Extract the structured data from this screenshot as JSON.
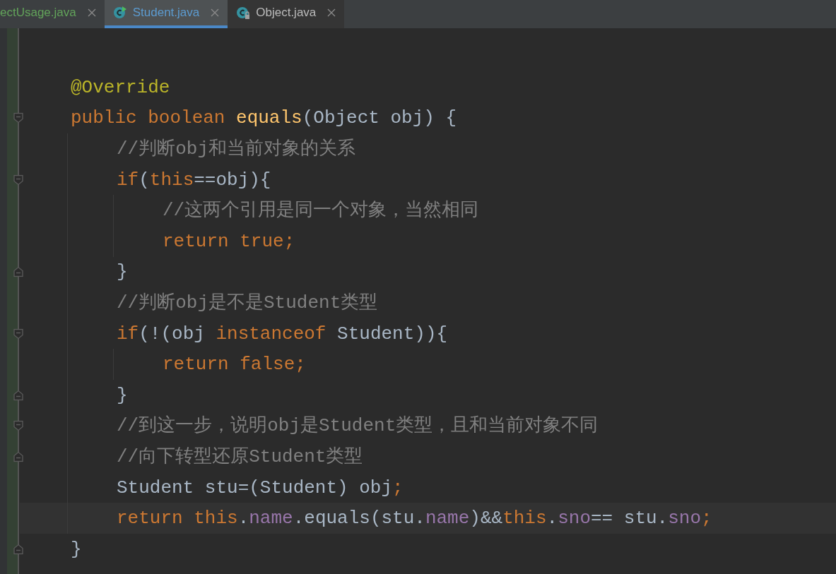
{
  "tabs": [
    {
      "label": "ectUsage.java",
      "selected": false,
      "kind": "plain",
      "color": "#62a35a"
    },
    {
      "label": "Student.java",
      "selected": true,
      "kind": "class-run",
      "color": "#5c9bd0"
    },
    {
      "label": "Object.java",
      "selected": false,
      "kind": "class-locked",
      "color": "#bbbbbb"
    }
  ],
  "code": [
    {
      "tokens": [
        {
          "text": "@Override",
          "kind": "annotation"
        }
      ]
    },
    {
      "kind": "fold-start",
      "tokens": [
        {
          "text": "public boolean ",
          "kind": "keyword"
        },
        {
          "text": "equals",
          "kind": "method"
        },
        {
          "text": "(Object obj) {",
          "kind": "plain"
        }
      ],
      "children": [
        {
          "tokens": [
            {
              "text": "//判断obj和当前对象的关系",
              "kind": "comment"
            }
          ]
        },
        {
          "kind": "fold-start",
          "tokens": [
            {
              "text": "if",
              "kind": "keyword"
            },
            {
              "text": "(",
              "kind": "plain"
            },
            {
              "text": "this",
              "kind": "keyword"
            },
            {
              "text": "==obj){",
              "kind": "plain"
            }
          ],
          "children": [
            {
              "tokens": [
                {
                  "text": "//这两个引用是同一个对象，当然相同",
                  "kind": "comment"
                }
              ]
            },
            {
              "tokens": [
                {
                  "text": "return true;",
                  "kind": "keyword"
                }
              ]
            }
          ]
        },
        {
          "kind": "fold-end",
          "tokens": [
            {
              "text": "}",
              "kind": "plain"
            }
          ]
        },
        {
          "tokens": [
            {
              "text": "//判断obj是不是Student类型",
              "kind": "comment"
            }
          ]
        },
        {
          "kind": "fold-start",
          "tokens": [
            {
              "text": "if",
              "kind": "keyword"
            },
            {
              "text": "(!(obj ",
              "kind": "plain"
            },
            {
              "text": "instanceof ",
              "kind": "keyword"
            },
            {
              "text": "Student)){",
              "kind": "plain"
            }
          ],
          "children": [
            {
              "tokens": [
                {
                  "text": "return false;",
                  "kind": "keyword"
                }
              ]
            }
          ]
        },
        {
          "kind": "fold-end",
          "tokens": [
            {
              "text": "}",
              "kind": "plain"
            }
          ]
        },
        {
          "kind": "fold-start",
          "tokens": [
            {
              "text": "//到这一步，说明obj是Student类型，且和当前对象不同",
              "kind": "comment"
            }
          ]
        },
        {
          "kind": "fold-end",
          "tokens": [
            {
              "text": "//向下转型还原Student类型",
              "kind": "comment"
            }
          ]
        },
        {
          "tokens": [
            {
              "text": "Student stu=(Student) obj",
              "kind": "plain"
            },
            {
              "text": ";",
              "kind": "keyword"
            }
          ]
        },
        {
          "current": true,
          "tokens": [
            {
              "text": "return this",
              "kind": "keyword"
            },
            {
              "text": ".",
              "kind": "plain"
            },
            {
              "text": "name",
              "kind": "field"
            },
            {
              "text": ".equals(stu.",
              "kind": "plain"
            },
            {
              "text": "name",
              "kind": "field"
            },
            {
              "text": ")&&",
              "kind": "plain"
            },
            {
              "text": "this",
              "kind": "keyword"
            },
            {
              "text": ".",
              "kind": "plain"
            },
            {
              "text": "sno",
              "kind": "field"
            },
            {
              "text": "== stu.",
              "kind": "plain"
            },
            {
              "text": "sno",
              "kind": "field"
            },
            {
              "text": ";",
              "kind": "keyword"
            }
          ]
        }
      ]
    },
    {
      "kind": "fold-end",
      "tokens": [
        {
          "text": "}",
          "kind": "plain"
        }
      ]
    }
  ]
}
